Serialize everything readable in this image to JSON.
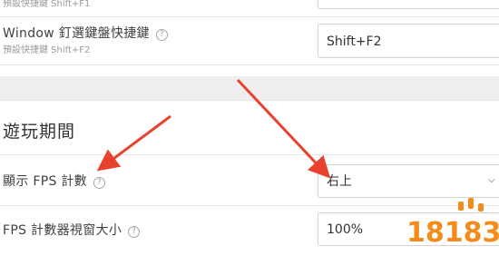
{
  "top_row": {
    "hint": "預設快捷鍵 Shift+F1"
  },
  "window_hotkey": {
    "label": "Window 釘選鍵盤快捷鍵",
    "hint": "預設快捷鍵 Shift+F2",
    "value": "Shift+F2"
  },
  "section": {
    "title": "遊玩期間"
  },
  "fps_display": {
    "label": "顯示 FPS 計數",
    "value": "右上"
  },
  "fps_window_size": {
    "label": "FPS 計數器視窗大小",
    "value": "100%"
  },
  "help_glyph": "?",
  "watermark": {
    "text": "18183",
    "color": "#f28c1a"
  },
  "arrow_color": "#e8412e"
}
